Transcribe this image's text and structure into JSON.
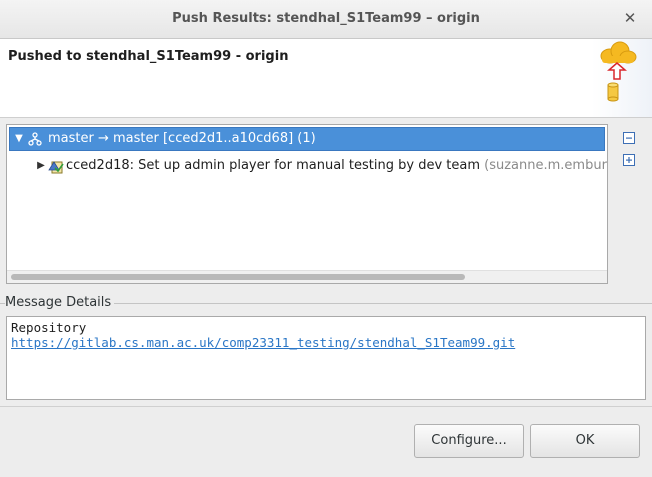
{
  "window": {
    "title": "Push Results: stendhal_S1Team99 – origin",
    "close_glyph": "✕"
  },
  "header": {
    "title": "Pushed to stendhal_S1Team99 - origin",
    "graphic_icon": "cloud-push-icon"
  },
  "tree": {
    "rows": [
      {
        "expander": "▼",
        "icon": "branch-icon",
        "label": "master → master [cced2d1..a10cd68] (1)"
      },
      {
        "expander": "▶",
        "icon": "commit-icon",
        "label": "cced2d18: Set up admin player for manual testing by dev team ",
        "author": "(suzanne.m.embury"
      }
    ],
    "side_buttons": [
      "collapse-all-icon",
      "expand-all-icon"
    ]
  },
  "details": {
    "label": "Message Details",
    "line1": "Repository",
    "link": "https://gitlab.cs.man.ac.uk/comp23311_testing/stendhal_S1Team99.git"
  },
  "buttons": {
    "configure_label": "Configure...",
    "ok_label": "OK"
  },
  "colors": {
    "selection": "#4a90d9",
    "link": "#2a76c6",
    "cloud": "#f5b921",
    "arrow": "#d9262b"
  }
}
